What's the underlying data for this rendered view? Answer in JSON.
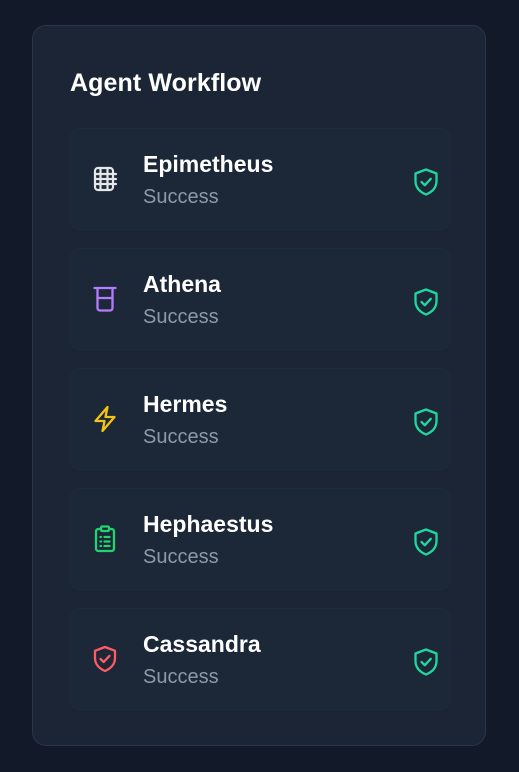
{
  "panel": {
    "title": "Agent Workflow"
  },
  "agents": [
    {
      "name": "Epimetheus",
      "status": "Success",
      "icon": "grid-tile-icon",
      "icon_color": "#e5e7eb"
    },
    {
      "name": "Athena",
      "status": "Success",
      "icon": "beaker-icon",
      "icon_color": "#b57bff"
    },
    {
      "name": "Hermes",
      "status": "Success",
      "icon": "lightning-bolt-icon",
      "icon_color": "#f3c316"
    },
    {
      "name": "Hephaestus",
      "status": "Success",
      "icon": "clipboard-list-icon",
      "icon_color": "#22d36f"
    },
    {
      "name": "Cassandra",
      "status": "Success",
      "icon": "shield-check-icon",
      "icon_color": "#ff5c63"
    }
  ],
  "status_icon": {
    "name": "shield-check-icon",
    "color": "#1ed8a0"
  }
}
